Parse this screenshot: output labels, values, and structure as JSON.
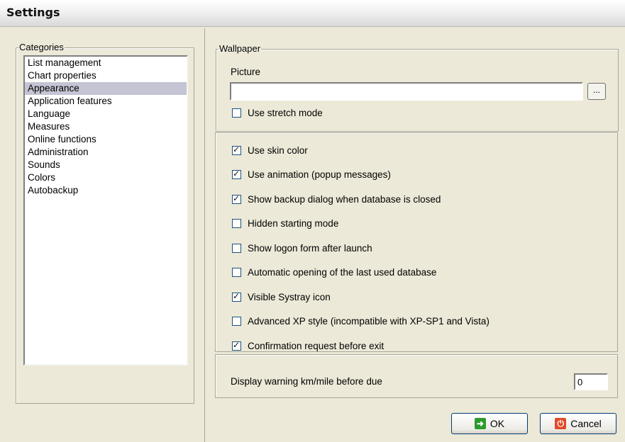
{
  "window": {
    "title": "Settings"
  },
  "categories": {
    "legend": "Categories",
    "items": [
      "List management",
      "Chart properties",
      "Appearance",
      "Application features",
      "Language",
      "Measures",
      "Online functions",
      "Administration",
      "Sounds",
      "Colors",
      "Autobackup"
    ],
    "selected": "Appearance"
  },
  "wallpaper": {
    "legend": "Wallpaper",
    "picture_label": "Picture",
    "picture_value": "",
    "browse_label": "...",
    "stretch": {
      "label": "Use stretch mode",
      "checked": false
    }
  },
  "options": [
    {
      "label": "Use skin color",
      "checked": true
    },
    {
      "label": "Use animation (popup messages)",
      "checked": true
    },
    {
      "label": "Show backup dialog when database is closed",
      "checked": true
    },
    {
      "label": "Hidden starting mode",
      "checked": false
    },
    {
      "label": "Show logon form after launch",
      "checked": false
    },
    {
      "label": "Automatic opening of the last used database",
      "checked": false
    },
    {
      "label": "Visible Systray icon",
      "checked": true
    },
    {
      "label": "Advanced XP style (incompatible with XP-SP1 and Vista)",
      "checked": false
    },
    {
      "label": "Confirmation request before exit",
      "checked": true
    }
  ],
  "warning": {
    "label": "Display warning km/mile before due",
    "value": "0"
  },
  "buttons": {
    "ok": "OK",
    "cancel": "Cancel"
  },
  "colors": {
    "selection": "#c4c4d4",
    "ok_icon": "#2d9a2d",
    "cancel_icon": "#e04a2a"
  }
}
